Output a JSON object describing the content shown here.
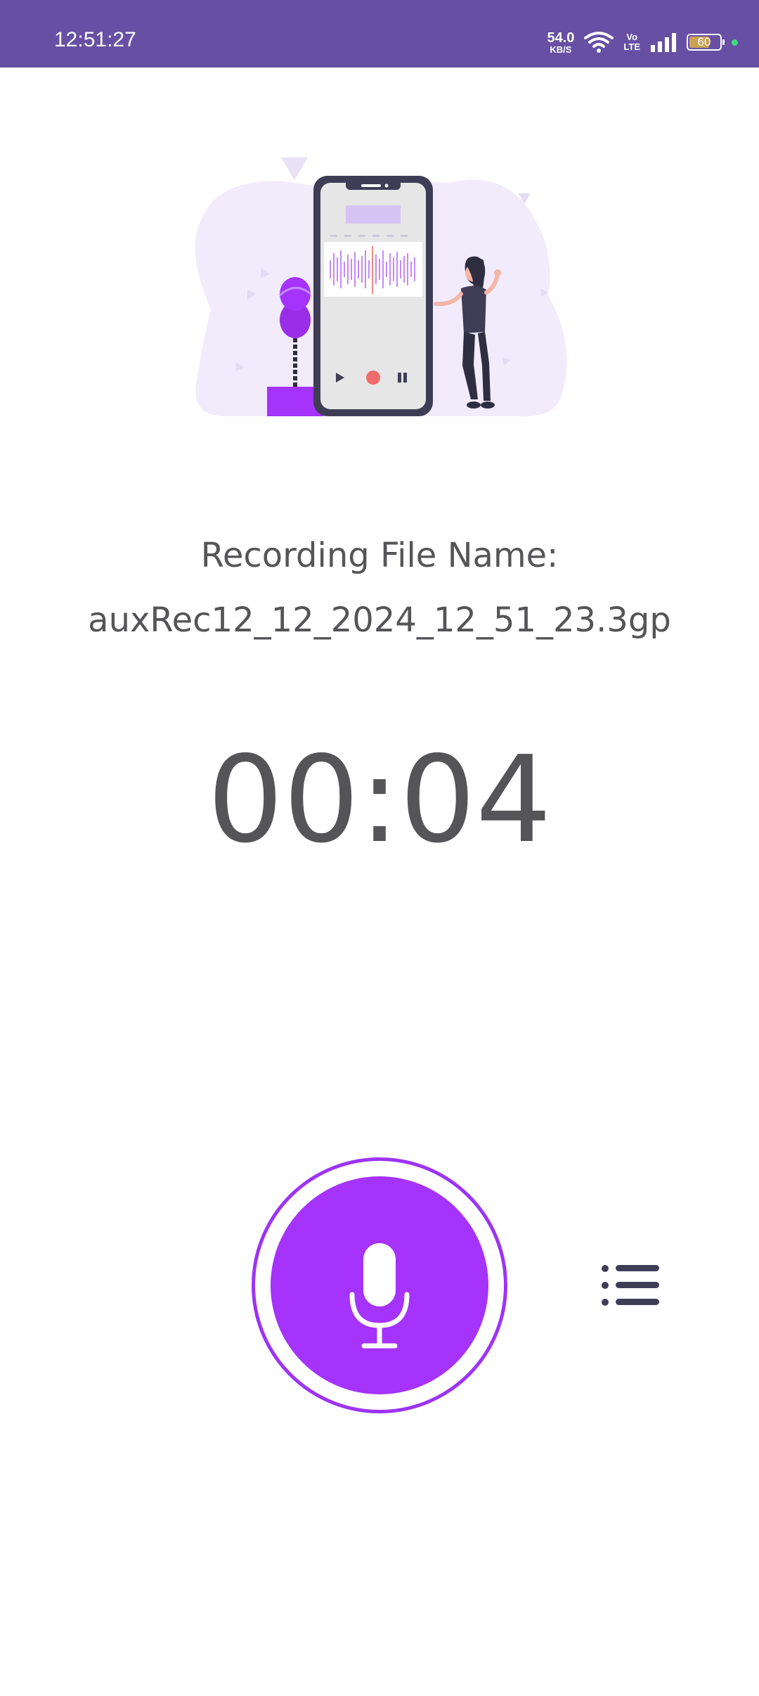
{
  "status_bar": {
    "time": "12:51:27",
    "net_speed_value": "54.0",
    "net_speed_unit": "KB/S",
    "volte_top": "Vo",
    "volte_bottom": "LTE",
    "battery_level": "60",
    "bg_color": "#6750a4"
  },
  "recording": {
    "file_label": "Recording File Name:",
    "file_name": "auxRec12_12_2024_12_51_23.3gp",
    "elapsed": "00:04"
  },
  "controls": {
    "record_icon": "microphone-icon",
    "list_icon": "list-icon",
    "accent_color": "#a533fb"
  }
}
